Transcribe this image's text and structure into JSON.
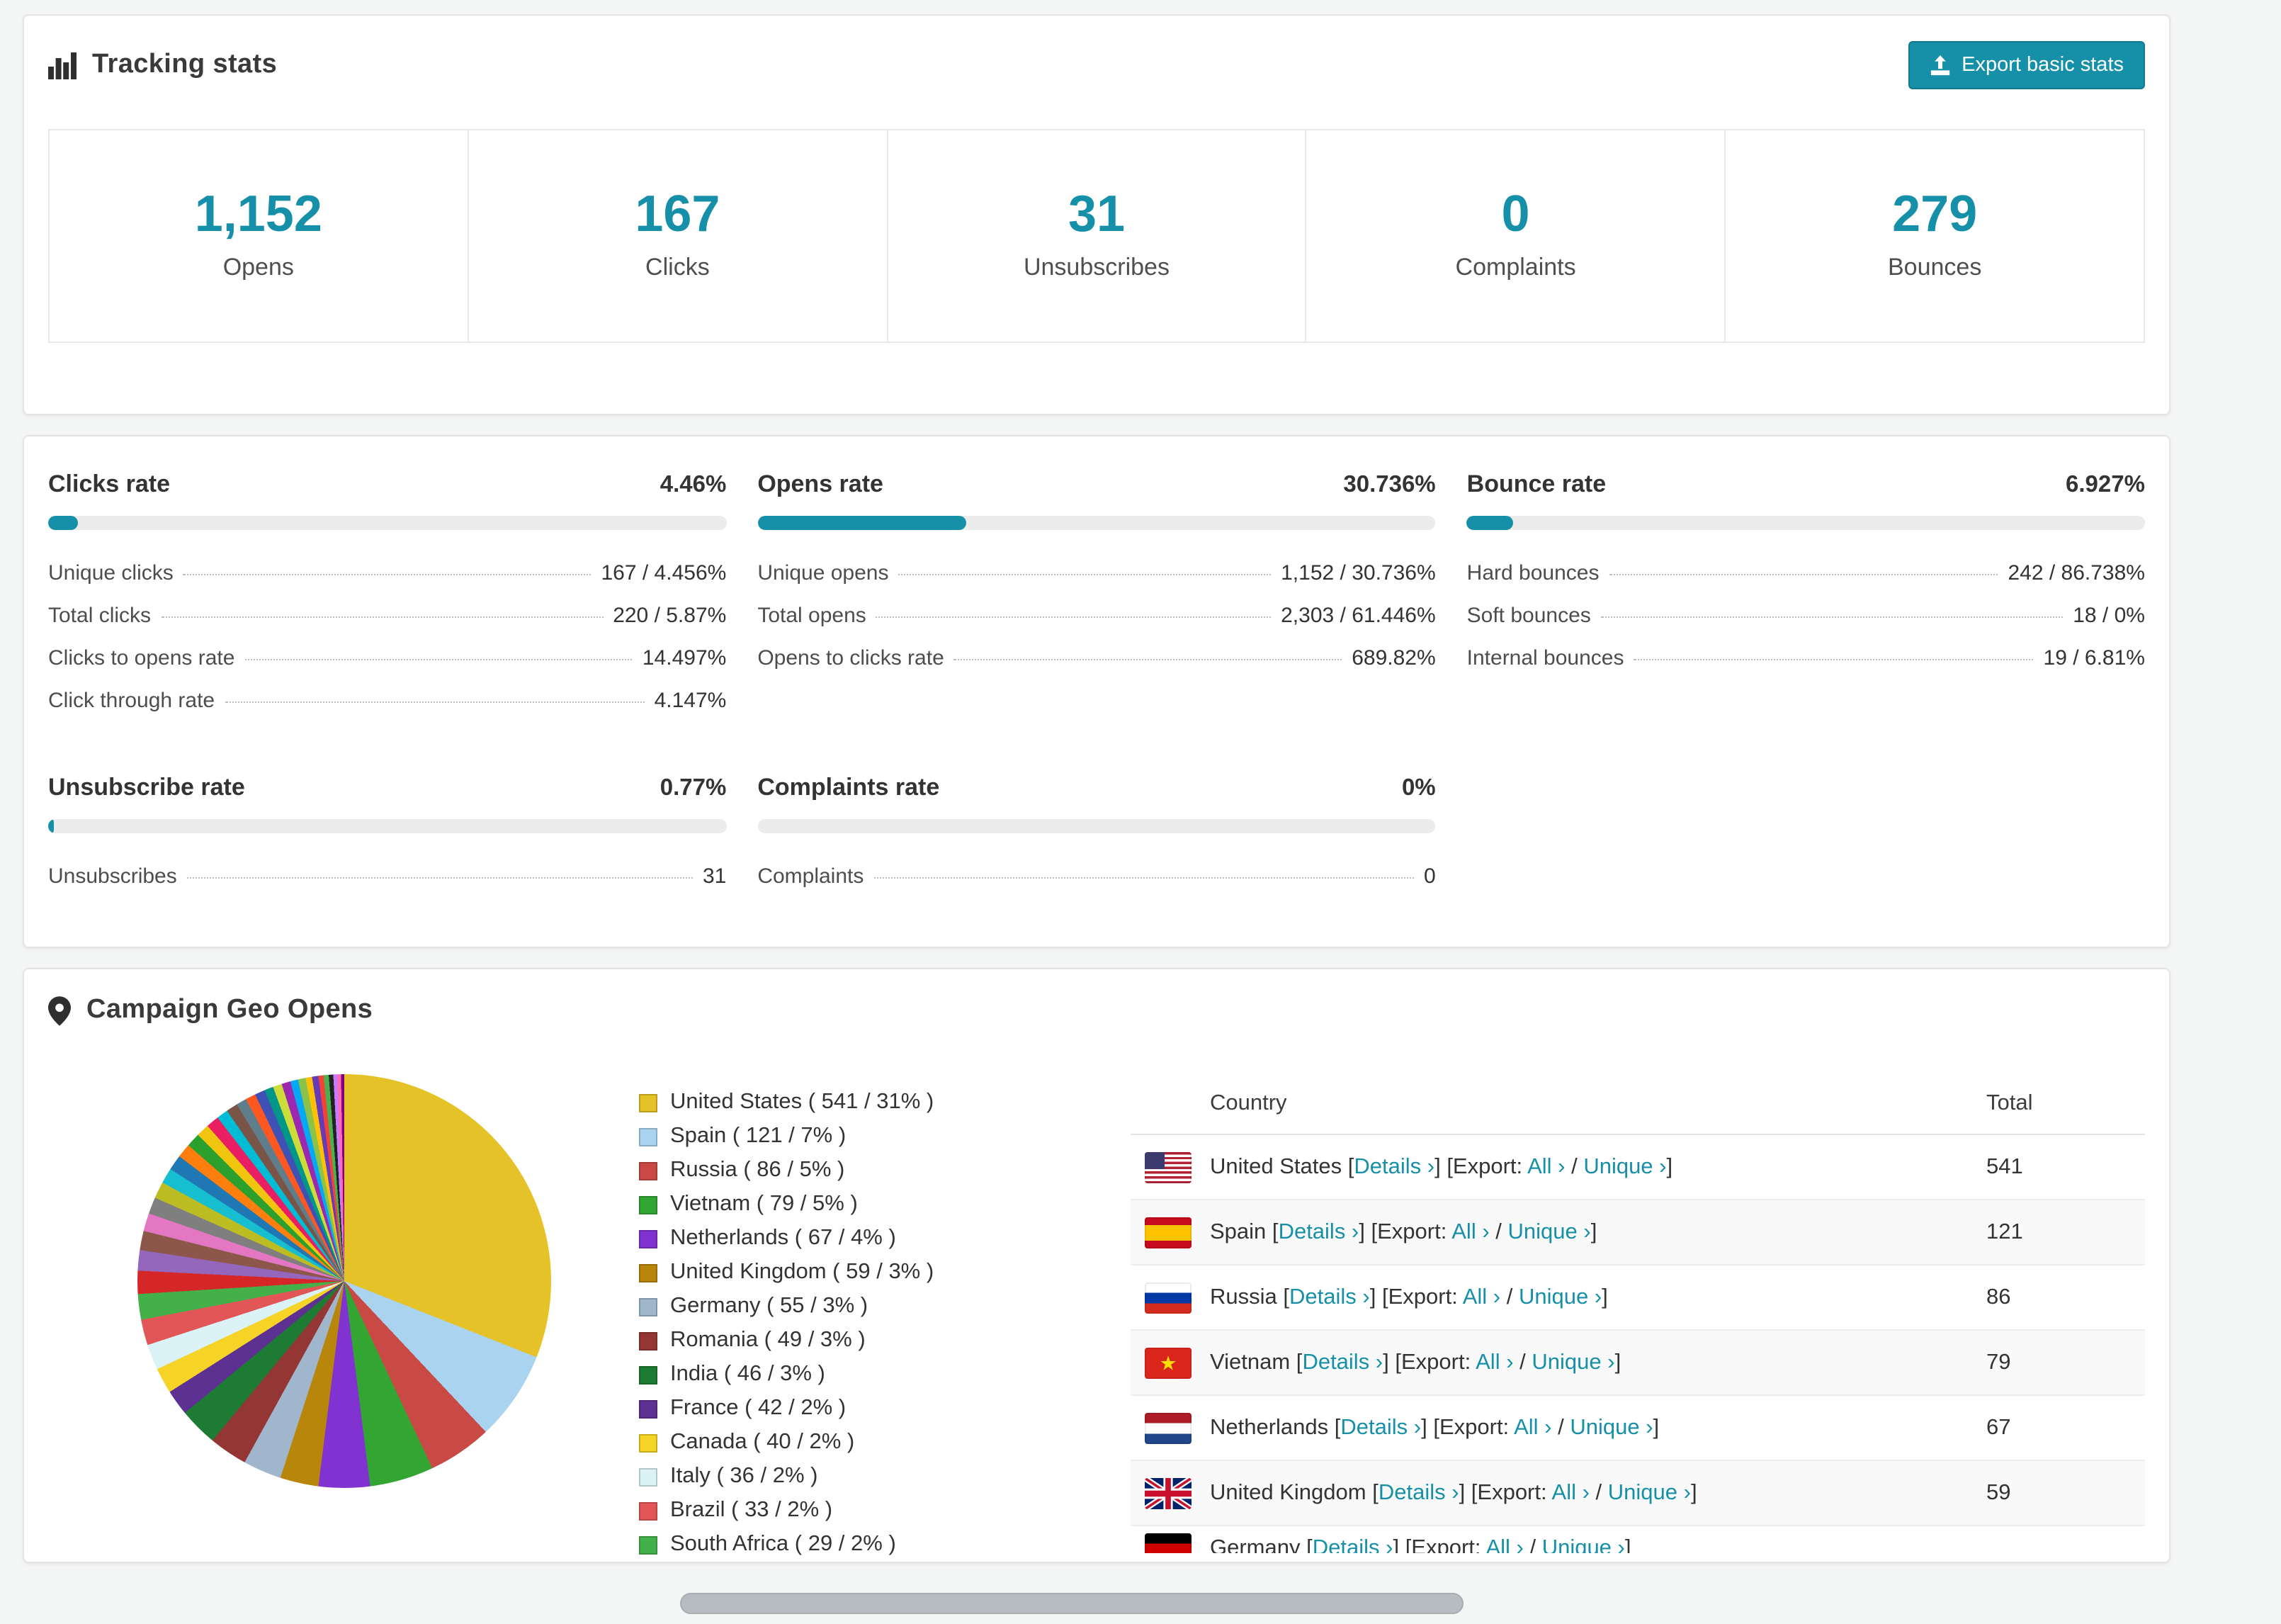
{
  "tracking": {
    "title": "Tracking stats",
    "export_button": "Export basic stats",
    "stats": [
      {
        "value": "1,152",
        "label": "Opens"
      },
      {
        "value": "167",
        "label": "Clicks"
      },
      {
        "value": "31",
        "label": "Unsubscribes"
      },
      {
        "value": "0",
        "label": "Complaints"
      },
      {
        "value": "279",
        "label": "Bounces"
      }
    ]
  },
  "rates": {
    "panels": [
      {
        "title": "Clicks rate",
        "value": "4.46%",
        "percent": 4.46,
        "rows": [
          {
            "label": "Unique clicks",
            "value": "167 / 4.456%"
          },
          {
            "label": "Total clicks",
            "value": "220 / 5.87%"
          },
          {
            "label": "Clicks to opens rate",
            "value": "14.497%"
          },
          {
            "label": "Click through rate",
            "value": "4.147%"
          }
        ]
      },
      {
        "title": "Opens rate",
        "value": "30.736%",
        "percent": 30.736,
        "rows": [
          {
            "label": "Unique opens",
            "value": "1,152 / 30.736%"
          },
          {
            "label": "Total opens",
            "value": "2,303 / 61.446%"
          },
          {
            "label": "Opens to clicks rate",
            "value": "689.82%"
          }
        ]
      },
      {
        "title": "Bounce rate",
        "value": "6.927%",
        "percent": 6.927,
        "rows": [
          {
            "label": "Hard bounces",
            "value": "242 / 86.738%"
          },
          {
            "label": "Soft bounces",
            "value": "18 / 0%"
          },
          {
            "label": "Internal bounces",
            "value": "19 / 6.81%"
          }
        ]
      },
      {
        "title": "Unsubscribe rate",
        "value": "0.77%",
        "percent": 0.77,
        "rows": [
          {
            "label": "Unsubscribes",
            "value": "31"
          }
        ]
      },
      {
        "title": "Complaints rate",
        "value": "0%",
        "percent": 0,
        "rows": [
          {
            "label": "Complaints",
            "value": "0"
          }
        ]
      }
    ],
    "accent_color": "#1690a8"
  },
  "geo": {
    "title": "Campaign Geo Opens",
    "table": {
      "country_header": "Country",
      "total_header": "Total",
      "fmt": {
        "lb": "[",
        "rb": "]",
        "details": "Details",
        "export": "Export:",
        "all": "All",
        "unique": "Unique",
        "chev": "›",
        "slash": "/"
      },
      "rows": [
        {
          "country": "United States",
          "flag": "us",
          "total": "541"
        },
        {
          "country": "Spain",
          "flag": "es",
          "total": "121"
        },
        {
          "country": "Russia",
          "flag": "ru",
          "total": "86"
        },
        {
          "country": "Vietnam",
          "flag": "vn",
          "total": "79"
        },
        {
          "country": "Netherlands",
          "flag": "nl",
          "total": "67"
        },
        {
          "country": "United Kingdom",
          "flag": "gb",
          "total": "59"
        },
        {
          "country": "Germany",
          "flag": "de",
          "total": "",
          "partial": true
        }
      ]
    }
  },
  "chart_data": {
    "type": "pie",
    "title": "Campaign Geo Opens",
    "legend_position": "right",
    "segments": [
      {
        "label": "United States",
        "count": 541,
        "pct": "31%",
        "value": 31,
        "color": "#e6c229"
      },
      {
        "label": "Spain",
        "count": 121,
        "pct": "7%",
        "value": 7,
        "color": "#a9d3ef"
      },
      {
        "label": "Russia",
        "count": 86,
        "pct": "5%",
        "value": 5,
        "color": "#c94a45"
      },
      {
        "label": "Vietnam",
        "count": 79,
        "pct": "5%",
        "value": 5,
        "color": "#33a532"
      },
      {
        "label": "Netherlands",
        "count": 67,
        "pct": "4%",
        "value": 4,
        "color": "#8133d1"
      },
      {
        "label": "United Kingdom",
        "count": 59,
        "pct": "3%",
        "value": 3,
        "color": "#b8860b"
      },
      {
        "label": "Germany",
        "count": 55,
        "pct": "3%",
        "value": 3,
        "color": "#9fb6cc"
      },
      {
        "label": "Romania",
        "count": 49,
        "pct": "3%",
        "value": 3,
        "color": "#943634"
      },
      {
        "label": "India",
        "count": 46,
        "pct": "3%",
        "value": 3,
        "color": "#1e7b33"
      },
      {
        "label": "France",
        "count": 42,
        "pct": "2%",
        "value": 2,
        "color": "#5d3191"
      },
      {
        "label": "Canada",
        "count": 40,
        "pct": "2%",
        "value": 2,
        "color": "#f5d327"
      },
      {
        "label": "Italy",
        "count": 36,
        "pct": "2%",
        "value": 2,
        "color": "#dbf3f7"
      },
      {
        "label": "Brazil",
        "count": 33,
        "pct": "2%",
        "value": 2,
        "color": "#e25658"
      },
      {
        "label": "South Africa",
        "count": 29,
        "pct": "2%",
        "value": 2,
        "color": "#43b04a"
      }
    ],
    "others": [
      {
        "c": "#d62728",
        "v": 1.8
      },
      {
        "c": "#9467bd",
        "v": 1.6
      },
      {
        "c": "#8c564b",
        "v": 1.5
      },
      {
        "c": "#e377c2",
        "v": 1.4
      },
      {
        "c": "#7f7f7f",
        "v": 1.3
      },
      {
        "c": "#bcbd22",
        "v": 1.3
      },
      {
        "c": "#17becf",
        "v": 1.2
      },
      {
        "c": "#1f77b4",
        "v": 1.2
      },
      {
        "c": "#ff7f0e",
        "v": 1.1
      },
      {
        "c": "#2ca02c",
        "v": 1.1
      },
      {
        "c": "#f1c40f",
        "v": 1.0
      },
      {
        "c": "#e91e63",
        "v": 1.0
      },
      {
        "c": "#00bcd4",
        "v": 0.9
      },
      {
        "c": "#795548",
        "v": 0.9
      },
      {
        "c": "#607d8b",
        "v": 0.8
      },
      {
        "c": "#ff5722",
        "v": 0.8
      },
      {
        "c": "#3f51b5",
        "v": 0.8
      },
      {
        "c": "#009688",
        "v": 0.7
      },
      {
        "c": "#cddc39",
        "v": 0.7
      },
      {
        "c": "#9c27b0",
        "v": 0.7
      },
      {
        "c": "#03a9f4",
        "v": 0.6
      },
      {
        "c": "#8bc34a",
        "v": 0.6
      },
      {
        "c": "#ffc107",
        "v": 0.5
      },
      {
        "c": "#673ab7",
        "v": 0.5
      },
      {
        "c": "#f44336",
        "v": 0.4
      },
      {
        "c": "#4caf50",
        "v": 0.4
      },
      {
        "c": "#222222",
        "v": 0.35
      },
      {
        "c": "#c77cff",
        "v": 0.3
      },
      {
        "c": "#ff69b4",
        "v": 0.3
      },
      {
        "c": "#800080",
        "v": 0.25
      }
    ]
  }
}
